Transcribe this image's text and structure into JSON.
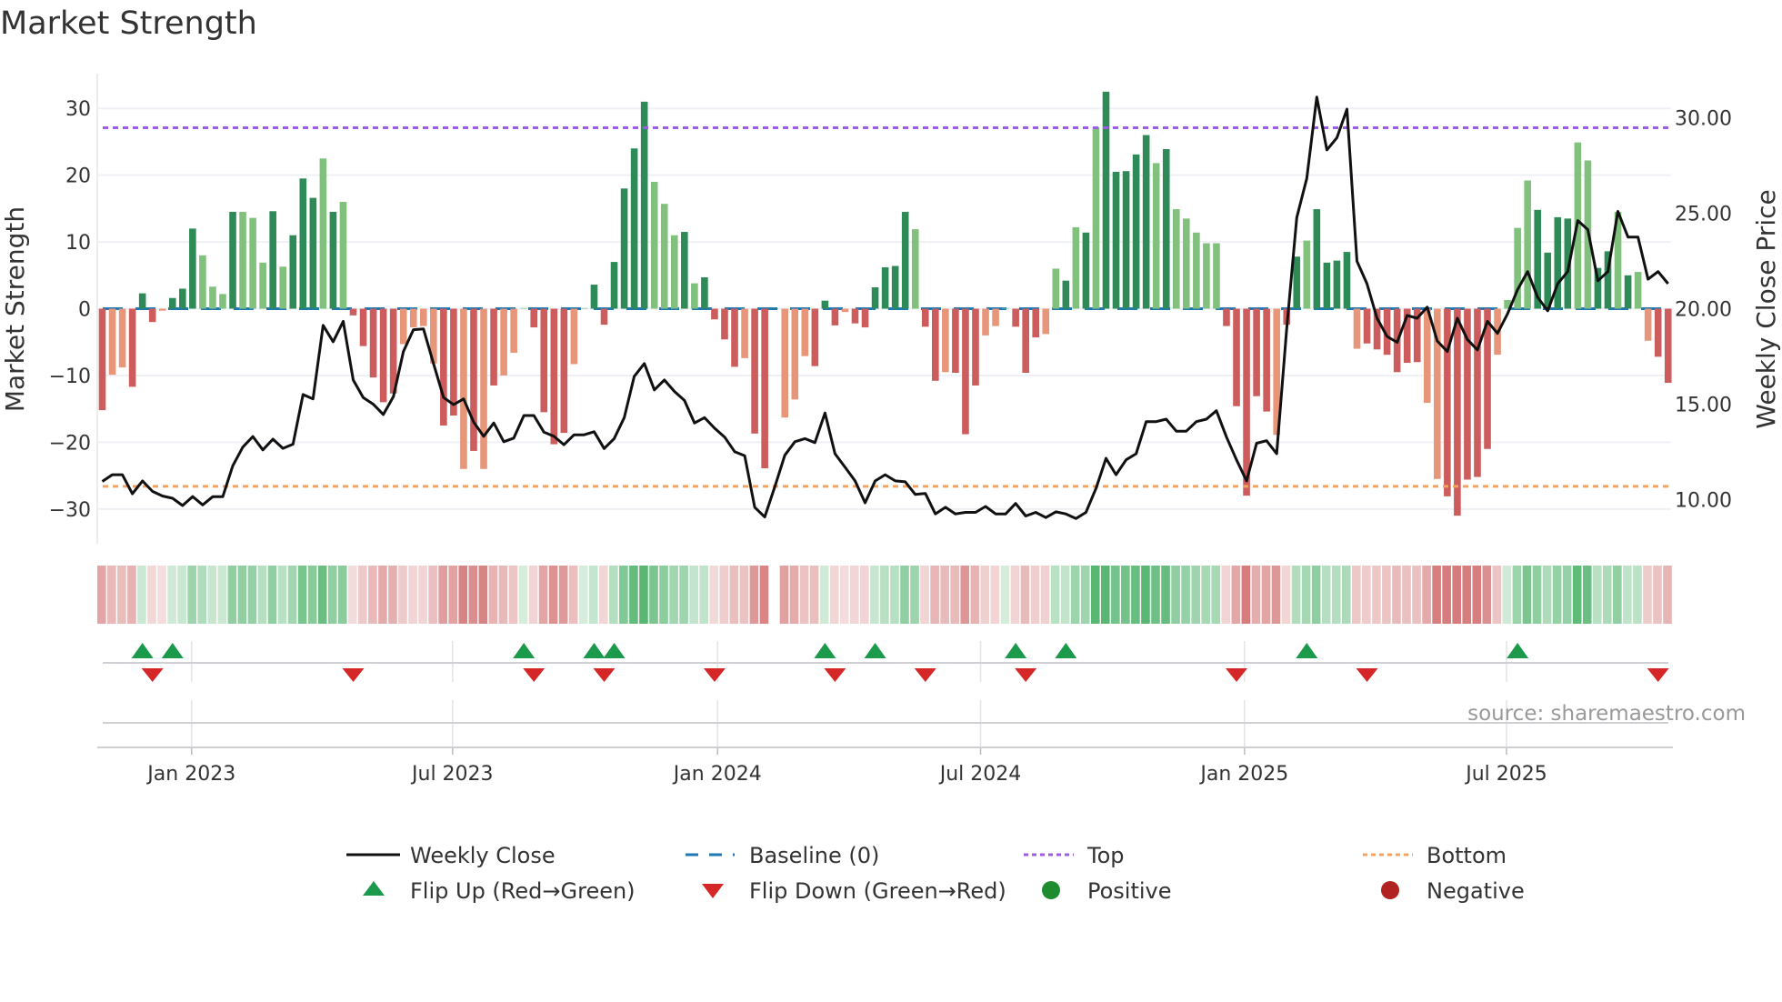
{
  "title": "Market Strength",
  "chart_data": {
    "type": "bar+line",
    "title": "Market Strength",
    "ylabel_left": "Market Strength",
    "ylabel_right": "Weekly Close Price",
    "ylim_left": [
      -35.2,
      35.2
    ],
    "ylim_right": [
      7.7,
      32.3
    ],
    "left_ticks": [
      30,
      20,
      10,
      0,
      -10,
      -20,
      -30
    ],
    "left_tick_labels": [
      "30",
      "20",
      "10",
      "0",
      "−10",
      "−20",
      "−30"
    ],
    "right_ticks": [
      30,
      25,
      20,
      15,
      10
    ],
    "right_tick_labels": [
      "30.00",
      "25.00",
      "20.00",
      "15.00",
      "10.00"
    ],
    "x_unit": "week index",
    "x_ticks": [
      {
        "week": 8.9,
        "label": "Jan 2023"
      },
      {
        "week": 34.9,
        "label": "Jul 2023"
      },
      {
        "week": 61.3,
        "label": "Jan 2024"
      },
      {
        "week": 87.5,
        "label": "Jul 2024"
      },
      {
        "week": 113.8,
        "label": "Jan 2025"
      },
      {
        "week": 139.9,
        "label": "Jul 2025"
      }
    ],
    "top_level": 27.1,
    "bottom_level": -26.6,
    "strength": [
      -15.2,
      -9.9,
      -8.8,
      -11.7,
      2.3,
      -2,
      -0.3,
      1.6,
      3,
      12,
      8,
      3.3,
      2.2,
      14.5,
      14.5,
      13.6,
      6.9,
      14.6,
      6.3,
      11,
      19.5,
      16.6,
      22.5,
      14.5,
      16,
      -1,
      -5.6,
      -10.3,
      -14,
      -12.7,
      -5.3,
      -2.8,
      -2.6,
      -8.2,
      -17.5,
      -16,
      -24,
      -21.3,
      -24,
      -11.5,
      -10,
      -6.6,
      0.1,
      -2.8,
      -15.5,
      -20.3,
      -18.6,
      -8.3,
      0.1,
      3.6,
      -2.4,
      7,
      18,
      24,
      31,
      19,
      15.7,
      11,
      11.5,
      3.8,
      4.7,
      -1.6,
      -4.6,
      -8.7,
      -7.4,
      -18.7,
      -23.9,
      0,
      -16.3,
      -13.6,
      -7.1,
      -8.6,
      1.2,
      -2.5,
      -0.5,
      -2.2,
      -2.8,
      3.2,
      6.2,
      6.4,
      14.5,
      11.9,
      -2.7,
      -10.8,
      -9.5,
      -9.6,
      -18.8,
      -11.5,
      -4,
      -2.6,
      0.1,
      -2.7,
      -9.6,
      -4.3,
      -3.8,
      6,
      4.2,
      12.2,
      11.4,
      27.2,
      32.5,
      20.5,
      20.6,
      23.1,
      26,
      21.8,
      23.9,
      14.9,
      13.5,
      11.4,
      9.8,
      9.8,
      -2.6,
      -14.6,
      -28,
      -13.1,
      -15.4,
      -18.9,
      -2.4,
      7.8,
      10.2,
      14.9,
      6.9,
      7.2,
      8.5,
      -6,
      -5.2,
      -6.1,
      -6.9,
      -9.5,
      -8.1,
      -8,
      -14.1,
      -25.5,
      -28.1,
      -31,
      -25.6,
      -25.2,
      -21,
      -6.9,
      1.3,
      12.1,
      19.2,
      14.8,
      8.4,
      13.7,
      13.5,
      24.9,
      22.2,
      6.1,
      8.6,
      14.5,
      5,
      5.5,
      -4.8,
      -7.2,
      -11.1
    ],
    "strong": "dlldddlddd llldllldldddldldddddllllddldldlllddddllddddddllldldddd ldddllldddlddddddlddldddllldddlldldldddddldllllldddddldd lddddlddddddlldddddllllddddllddldllddldddd",
    "weekly_close": [
      10.96,
      11.31,
      11.31,
      10.31,
      10.99,
      10.44,
      10.2,
      10.08,
      9.7,
      10.17,
      9.73,
      10.16,
      10.16,
      11.78,
      12.76,
      13.31,
      12.61,
      13.17,
      12.69,
      12.91,
      15.51,
      15.28,
      19.13,
      18.27,
      19.34,
      16.27,
      15.35,
      15.0,
      14.46,
      15.4,
      17.76,
      18.9,
      18.94,
      17.13,
      15.35,
      14.98,
      15.28,
      14.06,
      13.32,
      14.02,
      13.04,
      13.23,
      14.41,
      14.41,
      13.54,
      13.32,
      12.88,
      13.4,
      13.4,
      13.56,
      12.68,
      13.2,
      14.3,
      16.46,
      17.13,
      15.75,
      16.27,
      15.67,
      15.2,
      14.02,
      14.3,
      13.75,
      13.28,
      12.52,
      12.3,
      9.61,
      9.1,
      10.68,
      12.33,
      13.04,
      13.2,
      12.99,
      14.54,
      12.41,
      11.7,
      10.99,
      9.84,
      10.99,
      11.31,
      10.99,
      10.94,
      10.28,
      10.33,
      9.26,
      9.61,
      9.26,
      9.34,
      9.34,
      9.65,
      9.26,
      9.26,
      9.81,
      9.15,
      9.34,
      9.07,
      9.37,
      9.26,
      9.02,
      9.34,
      10.6,
      12.17,
      11.31,
      12.09,
      12.41,
      14.09,
      14.09,
      14.22,
      13.59,
      13.59,
      14.09,
      14.22,
      14.66,
      13.28,
      12.09,
      10.99,
      12.96,
      13.09,
      12.41,
      18.94,
      24.77,
      26.82,
      31.07,
      28.31,
      28.94,
      30.44,
      22.49,
      21.31,
      19.5,
      18.55,
      18.24,
      19.65,
      19.5,
      20.08,
      18.31,
      17.76,
      19.5,
      18.39,
      17.84,
      19.34,
      18.71,
      19.73,
      20.99,
      21.94,
      20.6,
      19.89,
      21.31,
      21.94,
      24.61,
      24.14,
      21.46,
      21.94,
      25.09,
      23.75,
      23.75,
      21.54,
      21.94,
      21.31
    ],
    "flip_up_weeks": [
      4,
      7,
      42,
      49,
      51,
      72,
      77,
      91,
      96,
      120,
      141
    ],
    "flip_down_weeks": [
      5,
      25,
      43,
      50,
      61,
      73,
      82,
      92,
      113,
      126,
      155
    ],
    "legend": {
      "weekly_close": "Weekly Close",
      "baseline": "Baseline (0)",
      "top": "Top",
      "bottom": "Bottom",
      "flip_up": "Flip Up (Red→Green)",
      "flip_down": "Flip Down (Green→Red)",
      "positive": "Positive",
      "negative": "Negative"
    },
    "legend_placement": "bottom",
    "source": "source: sharemaestro.com"
  },
  "colors": {
    "pos_strong": "#2e8b57",
    "pos_weak": "#82c07e",
    "neg_strong": "#cd5c5c",
    "neg_weak": "#e8967a",
    "baseline": "#1f77b4",
    "top": "#9b5de5",
    "bottom": "#f4a460",
    "flip_up": "#1a9a4a",
    "flip_down": "#d62728",
    "positive": "#1e8c2e",
    "negative": "#b22222",
    "line": "#111111"
  }
}
